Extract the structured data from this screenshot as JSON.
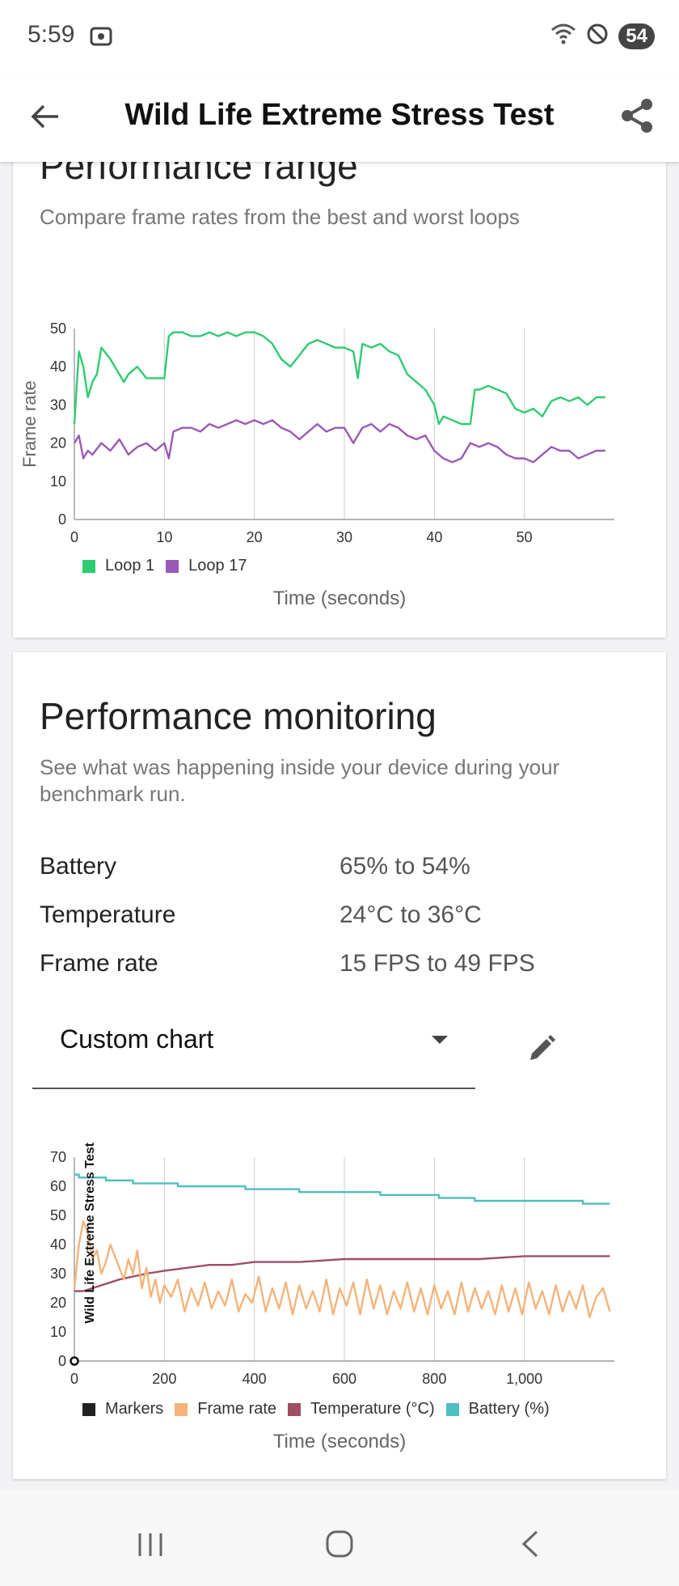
{
  "status": {
    "time": "5:59",
    "battery": "54"
  },
  "appbar": {
    "title": "Wild Life Extreme Stress Test"
  },
  "range": {
    "title": "Performance range",
    "subtitle": "Compare frame rates from the best and worst loops",
    "legend": [
      {
        "name": "Loop 1",
        "color": "#2ecc71"
      },
      {
        "name": "Loop 17",
        "color": "#9b59b6"
      }
    ],
    "x_title": "Time (seconds)",
    "y_title": "Frame rate"
  },
  "monitoring": {
    "title": "Performance monitoring",
    "subtitle": "See what was happening inside your device during your benchmark run.",
    "stats": [
      {
        "label": "Battery",
        "value": "65% to 54%"
      },
      {
        "label": "Temperature",
        "value": "24°C to 36°C"
      },
      {
        "label": "Frame rate",
        "value": "15 FPS to 49 FPS"
      }
    ],
    "select": {
      "label": "Custom chart"
    },
    "legend": [
      {
        "name": "Markers",
        "color": "#222222"
      },
      {
        "name": "Frame rate",
        "color": "#f5b37a"
      },
      {
        "name": "Temperature (°C)",
        "color": "#a04e64"
      },
      {
        "name": "Battery (%)",
        "color": "#4fbec0"
      }
    ],
    "x_title": "Time (seconds)",
    "marker_label": "Wild Life Extreme Stress Test"
  },
  "chart_data": [
    {
      "type": "line",
      "xlim": [
        0,
        60
      ],
      "ylim": [
        0,
        50
      ],
      "x_ticks": [
        "0",
        "10",
        "20",
        "30",
        "40",
        "50"
      ],
      "y_ticks": [
        "0",
        "10",
        "20",
        "30",
        "40",
        "50"
      ],
      "xlabel": "Time (seconds)",
      "ylabel": "Frame rate",
      "series": [
        {
          "name": "Loop 1",
          "color": "#2ecc71",
          "x": [
            0,
            0.5,
            1,
            1.5,
            2,
            2.5,
            3,
            4,
            5,
            5.5,
            6,
            7,
            8,
            9,
            10,
            10.5,
            11,
            12,
            13,
            14,
            15,
            16,
            17,
            18,
            19,
            20,
            21,
            22,
            23,
            24,
            25,
            26,
            27,
            28,
            29,
            30,
            31,
            31.5,
            32,
            33,
            34,
            35,
            36,
            37,
            38,
            39,
            40,
            40.5,
            41,
            42,
            43,
            44,
            44.5,
            45,
            46,
            47,
            48,
            49,
            50,
            51,
            52,
            53,
            54,
            55,
            56,
            57,
            58,
            59
          ],
          "y": [
            25,
            44,
            40,
            32,
            36,
            38,
            45,
            42,
            38,
            36,
            38,
            40,
            37,
            37,
            37,
            48,
            49,
            49,
            48,
            48,
            49,
            48,
            49,
            48,
            49,
            49,
            48,
            46,
            42,
            40,
            43,
            46,
            47,
            46,
            45,
            45,
            44,
            37,
            46,
            45,
            46,
            44,
            43,
            38,
            36,
            34,
            30,
            25,
            27,
            26,
            25,
            25,
            34,
            34,
            35,
            34,
            33,
            29,
            28,
            29,
            27,
            31,
            32,
            31,
            32,
            30,
            32,
            32
          ]
        },
        {
          "name": "Loop 17",
          "color": "#9b59b6",
          "x": [
            0,
            0.5,
            1,
            1.5,
            2,
            3,
            4,
            5,
            6,
            7,
            8,
            9,
            10,
            10.5,
            11,
            12,
            13,
            14,
            15,
            16,
            17,
            18,
            19,
            20,
            21,
            22,
            23,
            24,
            25,
            26,
            27,
            28,
            29,
            30,
            31,
            32,
            33,
            34,
            35,
            36,
            37,
            38,
            39,
            40,
            41,
            42,
            43,
            44,
            45,
            46,
            47,
            48,
            49,
            50,
            51,
            52,
            53,
            54,
            55,
            56,
            57,
            58,
            59
          ],
          "y": [
            20,
            22,
            16,
            18,
            17,
            20,
            18,
            21,
            17,
            19,
            20,
            18,
            20,
            16,
            23,
            24,
            24,
            23,
            25,
            24,
            25,
            26,
            25,
            26,
            25,
            26,
            24,
            23,
            21,
            23,
            25,
            23,
            24,
            24,
            20,
            24,
            25,
            23,
            25,
            24,
            22,
            21,
            22,
            18,
            16,
            15,
            16,
            20,
            19,
            20,
            19,
            17,
            16,
            16,
            15,
            17,
            19,
            18,
            18,
            16,
            17,
            18,
            18
          ]
        }
      ]
    },
    {
      "type": "line",
      "xlim": [
        0,
        1200
      ],
      "ylim": [
        0,
        70
      ],
      "x_ticks": [
        "0",
        "200",
        "400",
        "600",
        "800",
        "1,000"
      ],
      "y_ticks": [
        "0",
        "10",
        "20",
        "30",
        "40",
        "50",
        "60",
        "70"
      ],
      "xlabel": "Time (seconds)",
      "annotations": [
        {
          "x": 0,
          "text": "Wild Life Extreme Stress Test"
        }
      ],
      "series": [
        {
          "name": "Battery (%)",
          "color": "#4fbec0",
          "x": [
            0,
            10,
            10,
            70,
            70,
            130,
            130,
            230,
            230,
            380,
            380,
            500,
            500,
            680,
            680,
            810,
            810,
            890,
            890,
            1130,
            1130,
            1190
          ],
          "y": [
            64,
            64,
            63,
            63,
            62,
            62,
            61,
            61,
            60,
            60,
            59,
            59,
            58,
            58,
            57,
            57,
            56,
            56,
            55,
            55,
            54,
            54
          ]
        },
        {
          "name": "Temperature (°C)",
          "color": "#a04e64",
          "x": [
            0,
            20,
            40,
            60,
            80,
            100,
            130,
            160,
            200,
            250,
            300,
            350,
            400,
            500,
            600,
            700,
            800,
            900,
            1000,
            1100,
            1190
          ],
          "y": [
            24,
            24,
            25,
            26,
            27,
            28,
            29,
            30,
            31,
            32,
            33,
            33,
            34,
            34,
            35,
            35,
            35,
            35,
            36,
            36,
            36
          ]
        },
        {
          "name": "Frame rate",
          "color": "#f5b37a",
          "x": [
            0,
            10,
            20,
            30,
            40,
            50,
            60,
            70,
            80,
            90,
            100,
            110,
            120,
            130,
            140,
            150,
            160,
            170,
            180,
            190,
            200,
            215,
            230,
            245,
            260,
            275,
            290,
            305,
            320,
            335,
            350,
            365,
            380,
            395,
            410,
            425,
            440,
            455,
            470,
            485,
            500,
            515,
            530,
            545,
            560,
            575,
            590,
            605,
            620,
            635,
            650,
            665,
            680,
            695,
            710,
            725,
            740,
            755,
            770,
            785,
            800,
            815,
            830,
            845,
            860,
            875,
            890,
            905,
            920,
            935,
            950,
            965,
            980,
            995,
            1010,
            1025,
            1040,
            1055,
            1070,
            1085,
            1100,
            1115,
            1130,
            1145,
            1160,
            1175,
            1190
          ],
          "y": [
            25,
            40,
            48,
            44,
            35,
            38,
            30,
            34,
            40,
            36,
            32,
            28,
            35,
            30,
            38,
            25,
            32,
            22,
            28,
            20,
            26,
            22,
            28,
            17,
            25,
            19,
            27,
            18,
            24,
            19,
            28,
            17,
            23,
            20,
            29,
            17,
            25,
            18,
            27,
            16,
            26,
            18,
            24,
            17,
            28,
            16,
            25,
            19,
            27,
            16,
            28,
            18,
            26,
            16,
            24,
            18,
            27,
            17,
            25,
            16,
            26,
            18,
            24,
            16,
            27,
            17,
            25,
            18,
            24,
            16,
            26,
            17,
            25,
            16,
            27,
            18,
            24,
            16,
            26,
            17,
            24,
            18,
            26,
            15,
            22,
            25,
            17
          ]
        }
      ]
    }
  ]
}
